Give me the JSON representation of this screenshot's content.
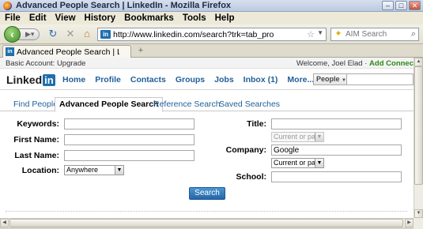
{
  "window": {
    "title": "Advanced People Search | LinkedIn - Mozilla Firefox",
    "minimize": "–",
    "maximize": "□",
    "close": "✕"
  },
  "menu": [
    "File",
    "Edit",
    "View",
    "History",
    "Bookmarks",
    "Tools",
    "Help"
  ],
  "toolbar": {
    "url": "http://www.linkedin.com/search?trk=tab_pro",
    "search_placeholder": "AIM Search",
    "site_icon_text": "in"
  },
  "tab": {
    "title": "Advanced People Search | Link...",
    "icon_text": "in",
    "new_tab": "+"
  },
  "topstrip": {
    "account": "Basic Account: Upgrade",
    "welcome": "Welcome, Joel Elad",
    "add_connections": "Add Connec"
  },
  "header": {
    "logo_text": "Linked",
    "logo_in": "in",
    "nav": [
      "Home",
      "Profile",
      "Contacts",
      "Groups",
      "Jobs",
      "Inbox (1)",
      "More..."
    ],
    "search_type": "People"
  },
  "subtabs": {
    "find_people": "Find People",
    "advanced": "Advanced People Search",
    "reference": "Reference Search",
    "saved": "Saved Searches"
  },
  "form": {
    "keywords_label": "Keywords:",
    "first_name_label": "First Name:",
    "last_name_label": "Last Name:",
    "location_label": "Location:",
    "location_value": "Anywhere",
    "title_label": "Title:",
    "title_scope": "Current or past",
    "company_label": "Company:",
    "company_value": "Google",
    "company_scope": "Current or past",
    "school_label": "School:",
    "search_button": "Search"
  }
}
